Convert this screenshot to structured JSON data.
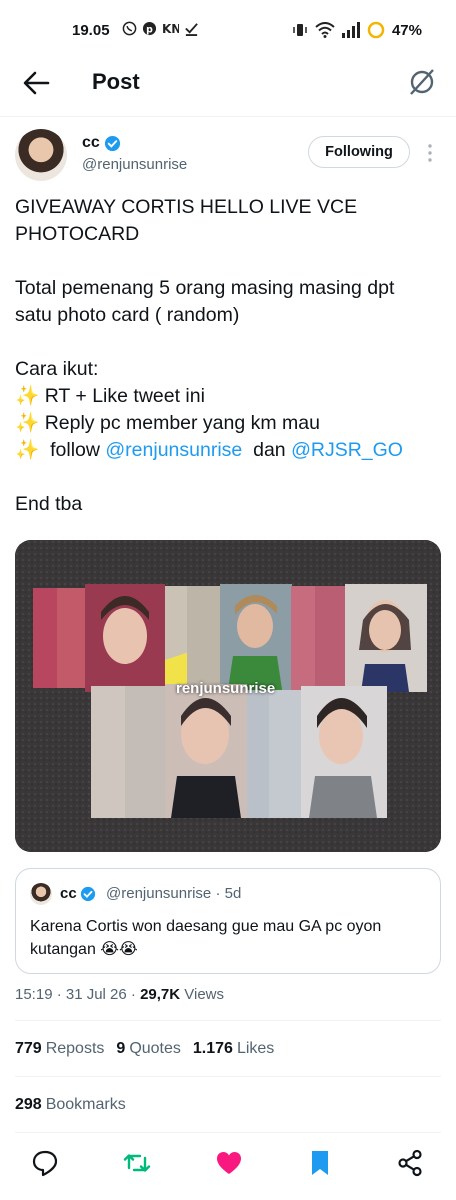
{
  "status_bar": {
    "time": "19.05",
    "battery": "47%",
    "left_icons": [
      "whatsapp-icon",
      "pinterest-icon",
      "app-icon",
      "download-done-icon"
    ],
    "right_icons": [
      "vibrate-icon",
      "wifi-icon",
      "signal-icon",
      "battery-icon"
    ]
  },
  "header": {
    "title": "Post",
    "back_icon": "arrow-left-icon",
    "grok_icon": "grok-icon"
  },
  "author": {
    "name": "cc",
    "handle": "@renjunsunrise",
    "verified": true,
    "follow_label": "Following"
  },
  "tweet": {
    "line1": "GIVEAWAY CORTIS HELLO LIVE VCE",
    "line2": "PHOTOCARD",
    "line3": "Total pemenang 5 orang masing masing dpt",
    "line4": "satu photo card ( random)",
    "line5": "Cara ikut:",
    "sparkle": "✨",
    "line6": " RT + Like tweet ini",
    "line7": " Reply pc member yang km mau",
    "line8_a": "  follow ",
    "mention1": "@renjunsunrise",
    "line8_b": "  dan ",
    "mention2": "@RJSR_GO",
    "line9": "End tba",
    "image_watermark": "renjunsunrise"
  },
  "quote": {
    "name": "cc",
    "handle": "@renjunsunrise · 5d",
    "text": "Karena Cortis won daesang gue mau GA pc oyon kutangan 😭😭"
  },
  "meta": {
    "time_date": "15:19 · 31 Jul 26 · ",
    "views_count": "29,7K",
    "views_label": " Views"
  },
  "stats": {
    "reposts_count": "779",
    "reposts_label": "Reposts",
    "quotes_count": "9",
    "quotes_label": "Quotes",
    "likes_count": "1.176",
    "likes_label": "Likes",
    "bookmarks_count": "298",
    "bookmarks_label": "Bookmarks"
  },
  "actions": [
    "reply-icon",
    "repost-icon",
    "like-icon",
    "bookmark-icon",
    "share-icon"
  ],
  "colors": {
    "accent": "#1d9bf0",
    "repost": "#00ba7c",
    "like": "#f91880",
    "text": "#0f1419",
    "secondary": "#536471"
  }
}
